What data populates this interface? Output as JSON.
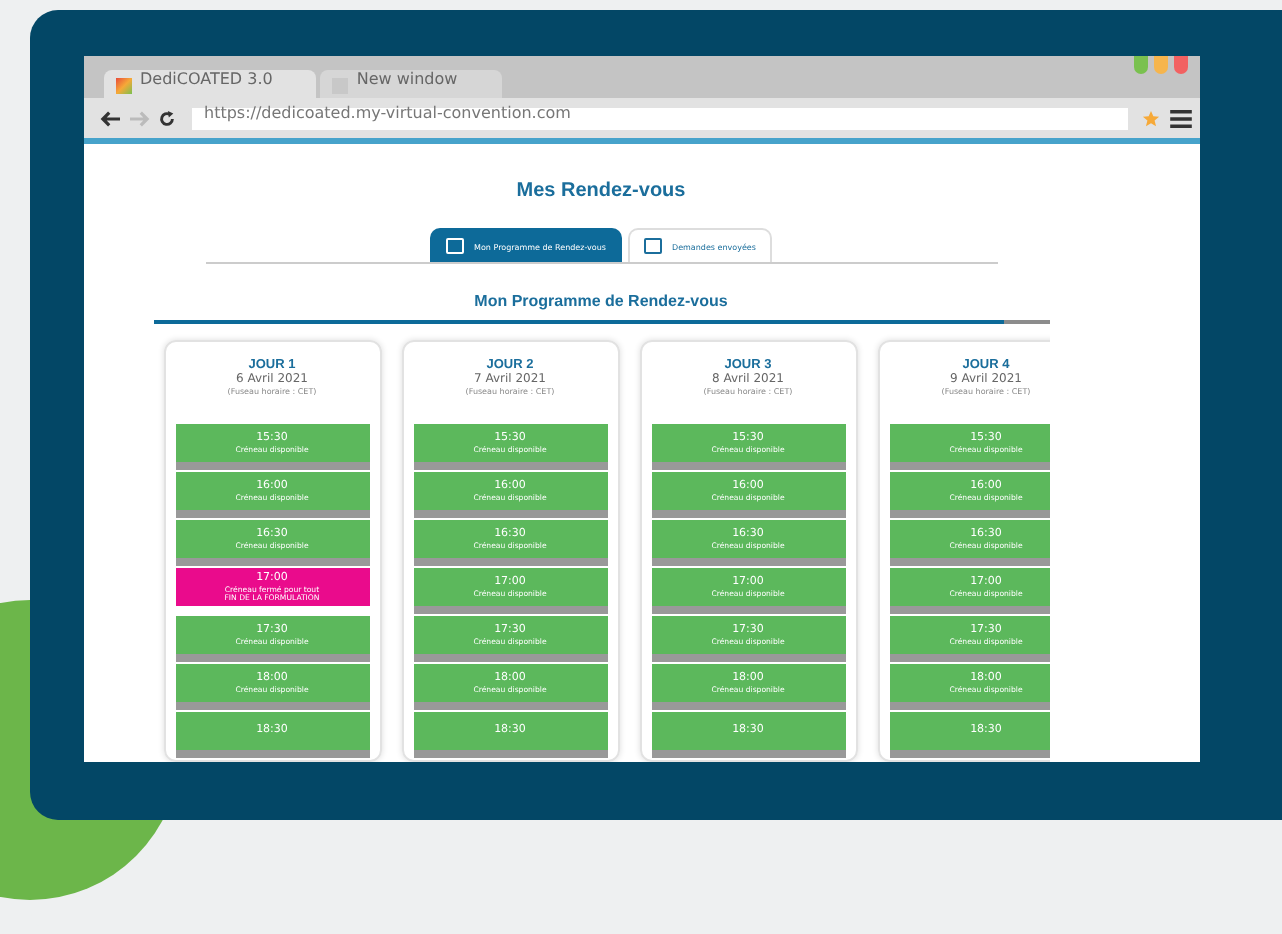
{
  "browser": {
    "tabs": [
      {
        "label": "DediCOATED 3.0",
        "selected": true
      },
      {
        "label": "New window",
        "selected": false
      }
    ],
    "url": "https://dedicoated.my-virtual-convention.com"
  },
  "page": {
    "title": "Mes Rendez-vous",
    "tabs": [
      {
        "label": "Mon Programme de Rendez-vous",
        "selected": true
      },
      {
        "label": "Demandes envoyées",
        "selected": false
      }
    ],
    "subtitle": "Mon Programme de Rendez-vous",
    "progress": {
      "level": 0.95
    },
    "days": [
      {
        "title": "JOUR 1",
        "date": "6 Avril 2021",
        "timezone": "(Fuseau horaire : CET)",
        "slots": [
          {
            "time": "15:30",
            "status": "Créneau disponible",
            "kind": "available"
          },
          {
            "time": "16:00",
            "status": "Créneau disponible",
            "kind": "available"
          },
          {
            "time": "16:30",
            "status": "Créneau disponible",
            "kind": "available"
          },
          {
            "time": "17:00",
            "status": "Créneau fermé pour tout",
            "note": "FIN DE LA FORMULATION",
            "kind": "closed"
          },
          {
            "time": "17:30",
            "status": "Créneau disponible",
            "kind": "available"
          },
          {
            "time": "18:00",
            "status": "Créneau disponible",
            "kind": "available"
          },
          {
            "time": "18:30",
            "kind": "available"
          }
        ]
      },
      {
        "title": "JOUR 2",
        "date": "7 Avril 2021",
        "timezone": "(Fuseau horaire : CET)",
        "slots": [
          {
            "time": "15:30",
            "status": "Créneau disponible",
            "kind": "available"
          },
          {
            "time": "16:00",
            "status": "Créneau disponible",
            "kind": "available"
          },
          {
            "time": "16:30",
            "status": "Créneau disponible",
            "kind": "available"
          },
          {
            "time": "17:00",
            "status": "Créneau disponible",
            "kind": "available"
          },
          {
            "time": "17:30",
            "status": "Créneau disponible",
            "kind": "available"
          },
          {
            "time": "18:00",
            "status": "Créneau disponible",
            "kind": "available"
          },
          {
            "time": "18:30",
            "kind": "available"
          }
        ]
      },
      {
        "title": "JOUR 3",
        "date": "8 Avril 2021",
        "timezone": "(Fuseau horaire : CET)",
        "slots": [
          {
            "time": "15:30",
            "status": "Créneau disponible",
            "kind": "available"
          },
          {
            "time": "16:00",
            "status": "Créneau disponible",
            "kind": "available"
          },
          {
            "time": "16:30",
            "status": "Créneau disponible",
            "kind": "available"
          },
          {
            "time": "17:00",
            "status": "Créneau disponible",
            "kind": "available"
          },
          {
            "time": "17:30",
            "status": "Créneau disponible",
            "kind": "available"
          },
          {
            "time": "18:00",
            "status": "Créneau disponible",
            "kind": "available"
          },
          {
            "time": "18:30",
            "kind": "available"
          }
        ]
      },
      {
        "title": "JOUR 4",
        "date": "9 Avril 2021",
        "timezone": "(Fuseau horaire : CET)",
        "slots": [
          {
            "time": "15:30",
            "status": "Créneau disponible",
            "kind": "available"
          },
          {
            "time": "16:00",
            "status": "Créneau disponible",
            "kind": "available"
          },
          {
            "time": "16:30",
            "status": "Créneau disponible",
            "kind": "available"
          },
          {
            "time": "17:00",
            "status": "Créneau disponible",
            "kind": "available"
          },
          {
            "time": "17:30",
            "status": "Créneau disponible",
            "kind": "available"
          },
          {
            "time": "18:00",
            "status": "Créneau disponible",
            "kind": "available"
          },
          {
            "time": "18:30",
            "kind": "available"
          }
        ]
      }
    ]
  }
}
